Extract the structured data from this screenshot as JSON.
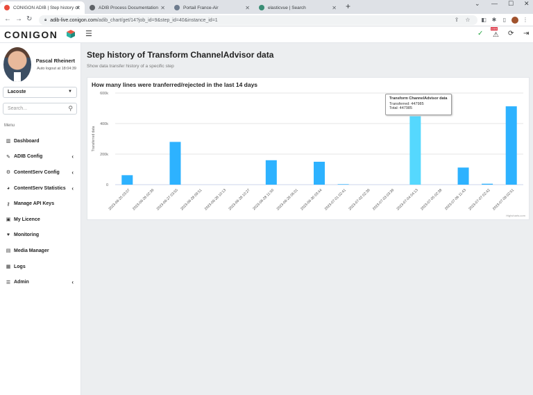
{
  "browser": {
    "tabs": [
      {
        "label": "CONIGON ADIB | Step history of",
        "active": true,
        "fav": "#e94b3c"
      },
      {
        "label": "ADIB Process Documentation",
        "active": false,
        "fav": "#5f6368"
      },
      {
        "label": "Portail France-Air",
        "active": false,
        "fav": "#6d7b8d"
      },
      {
        "label": "elasticvue | Search",
        "active": false,
        "fav": "#3a8d75"
      }
    ],
    "url_host": "adib-live.conigon.com",
    "url_path": "/adib_chart/get/14?job_id=9&step_id=40&instance_id=1"
  },
  "app": {
    "logo_text": "CONIGON",
    "header_badge": "ERR"
  },
  "user": {
    "name": "Pascal Rheinert",
    "autologout": "Auto logout at 18:04:39"
  },
  "tenant": "Lacoste",
  "search": {
    "placeholder": "Search..."
  },
  "menu_label": "Menu",
  "menu": [
    {
      "label": "Dashboard",
      "icon": "chart-icon",
      "glyph": "▥",
      "chevron": false
    },
    {
      "label": "ADIB Config",
      "icon": "wrench-icon",
      "glyph": "✎",
      "chevron": true
    },
    {
      "label": "ContentServ Config",
      "icon": "gear-icon",
      "glyph": "⚙",
      "chevron": true
    },
    {
      "label": "ContentServ Statistics",
      "icon": "pie-icon",
      "glyph": "◕",
      "chevron": true
    },
    {
      "label": "Manage API Keys",
      "icon": "key-icon",
      "glyph": "⚷",
      "chevron": false
    },
    {
      "label": "My Licence",
      "icon": "lock-icon",
      "glyph": "▣",
      "chevron": false
    },
    {
      "label": "Monitoring",
      "icon": "heartbeat-icon",
      "glyph": "♥",
      "chevron": false
    },
    {
      "label": "Media Manager",
      "icon": "file-icon",
      "glyph": "▤",
      "chevron": false
    },
    {
      "label": "Logs",
      "icon": "logs-icon",
      "glyph": "▦",
      "chevron": false
    },
    {
      "label": "Admin",
      "icon": "list-icon",
      "glyph": "☰",
      "chevron": true
    }
  ],
  "page": {
    "title": "Step history of Transform ChannelAdvisor data",
    "subtitle": "Show data transfer history of a specific step"
  },
  "chart_data": {
    "type": "bar",
    "title": "How many lines were tranferred/rejected in the last 14 days",
    "ylabel": "Transferred data",
    "ylim": [
      0,
      600000
    ],
    "yticks": [
      "0",
      "200k",
      "400k",
      "600k"
    ],
    "categories": [
      "2023-06-25 03:07",
      "2023-06-26 02:39",
      "2023-06-27 03:55",
      "2023-06-28 09:51",
      "2023-06-28 10:13",
      "2023-06-28 10:27",
      "2023-06-28 11:50",
      "2023-06-29 06:01",
      "2023-06-30 03:44",
      "2023-07-01 02:41",
      "2023-07-02 02:39",
      "2023-07-03 03:39",
      "2023-07-04 04:13",
      "2023-07-05 02:38",
      "2023-07-06 11:43",
      "2023-07-07 02:42",
      "2023-07-08 02:51"
    ],
    "values": [
      62000,
      0,
      280000,
      0,
      0,
      0,
      160000,
      0,
      150000,
      3000,
      0,
      0,
      447985,
      0,
      112000,
      6000,
      513000
    ],
    "highlight_index": 12,
    "bar_color": "#2db2ff",
    "highlight_color": "#55d8fe",
    "credits": "Highcharts.com"
  },
  "tooltip": {
    "title": "Transform ChannelAdvisor data",
    "line1": "Transferred: 447985",
    "line2": "Total: 447985"
  }
}
